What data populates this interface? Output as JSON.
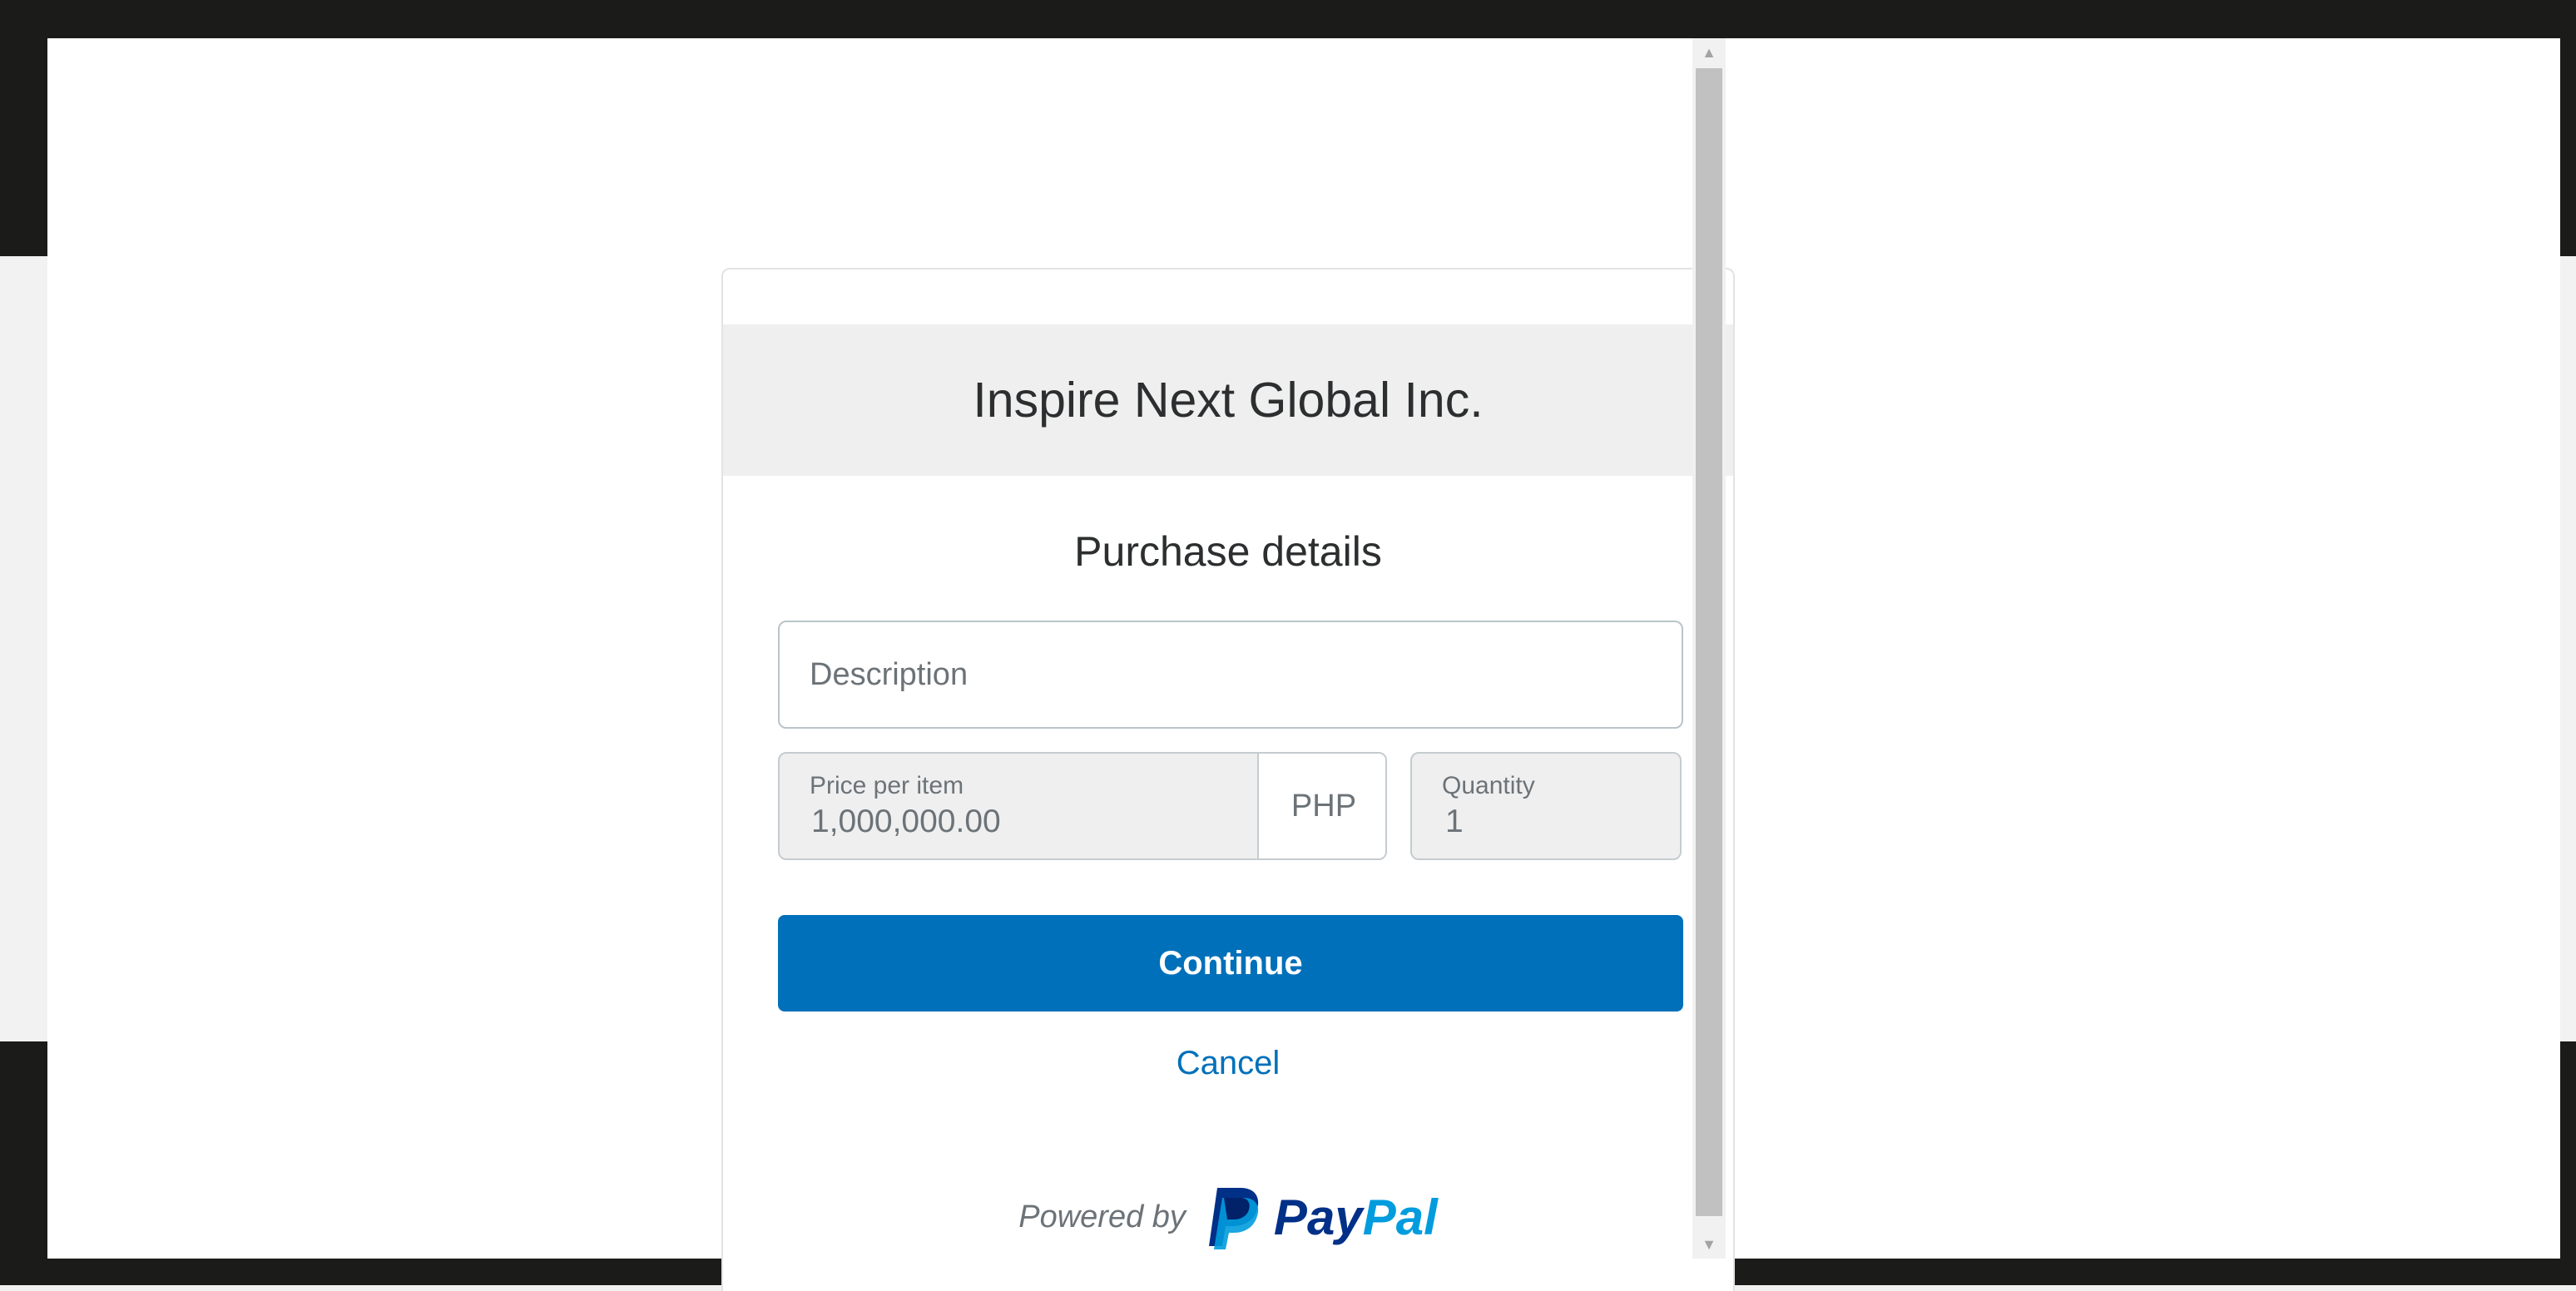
{
  "merchant": {
    "name": "Inspire Next Global Inc."
  },
  "form": {
    "title": "Purchase details",
    "description_placeholder": "Description",
    "price_label": "Price per item",
    "price_value": "1,000,000.00",
    "currency": "PHP",
    "quantity_label": "Quantity",
    "quantity_value": "1"
  },
  "actions": {
    "continue_label": "Continue",
    "cancel_label": "Cancel"
  },
  "footer": {
    "powered_by": "Powered by",
    "brand_pay": "Pay",
    "brand_pal": "Pal"
  },
  "scrollbar": {
    "up_icon": "▲",
    "down_icon": "▼"
  },
  "colors": {
    "accent": "#0070ba",
    "paypal_dark": "#003087",
    "paypal_light": "#009cde"
  }
}
